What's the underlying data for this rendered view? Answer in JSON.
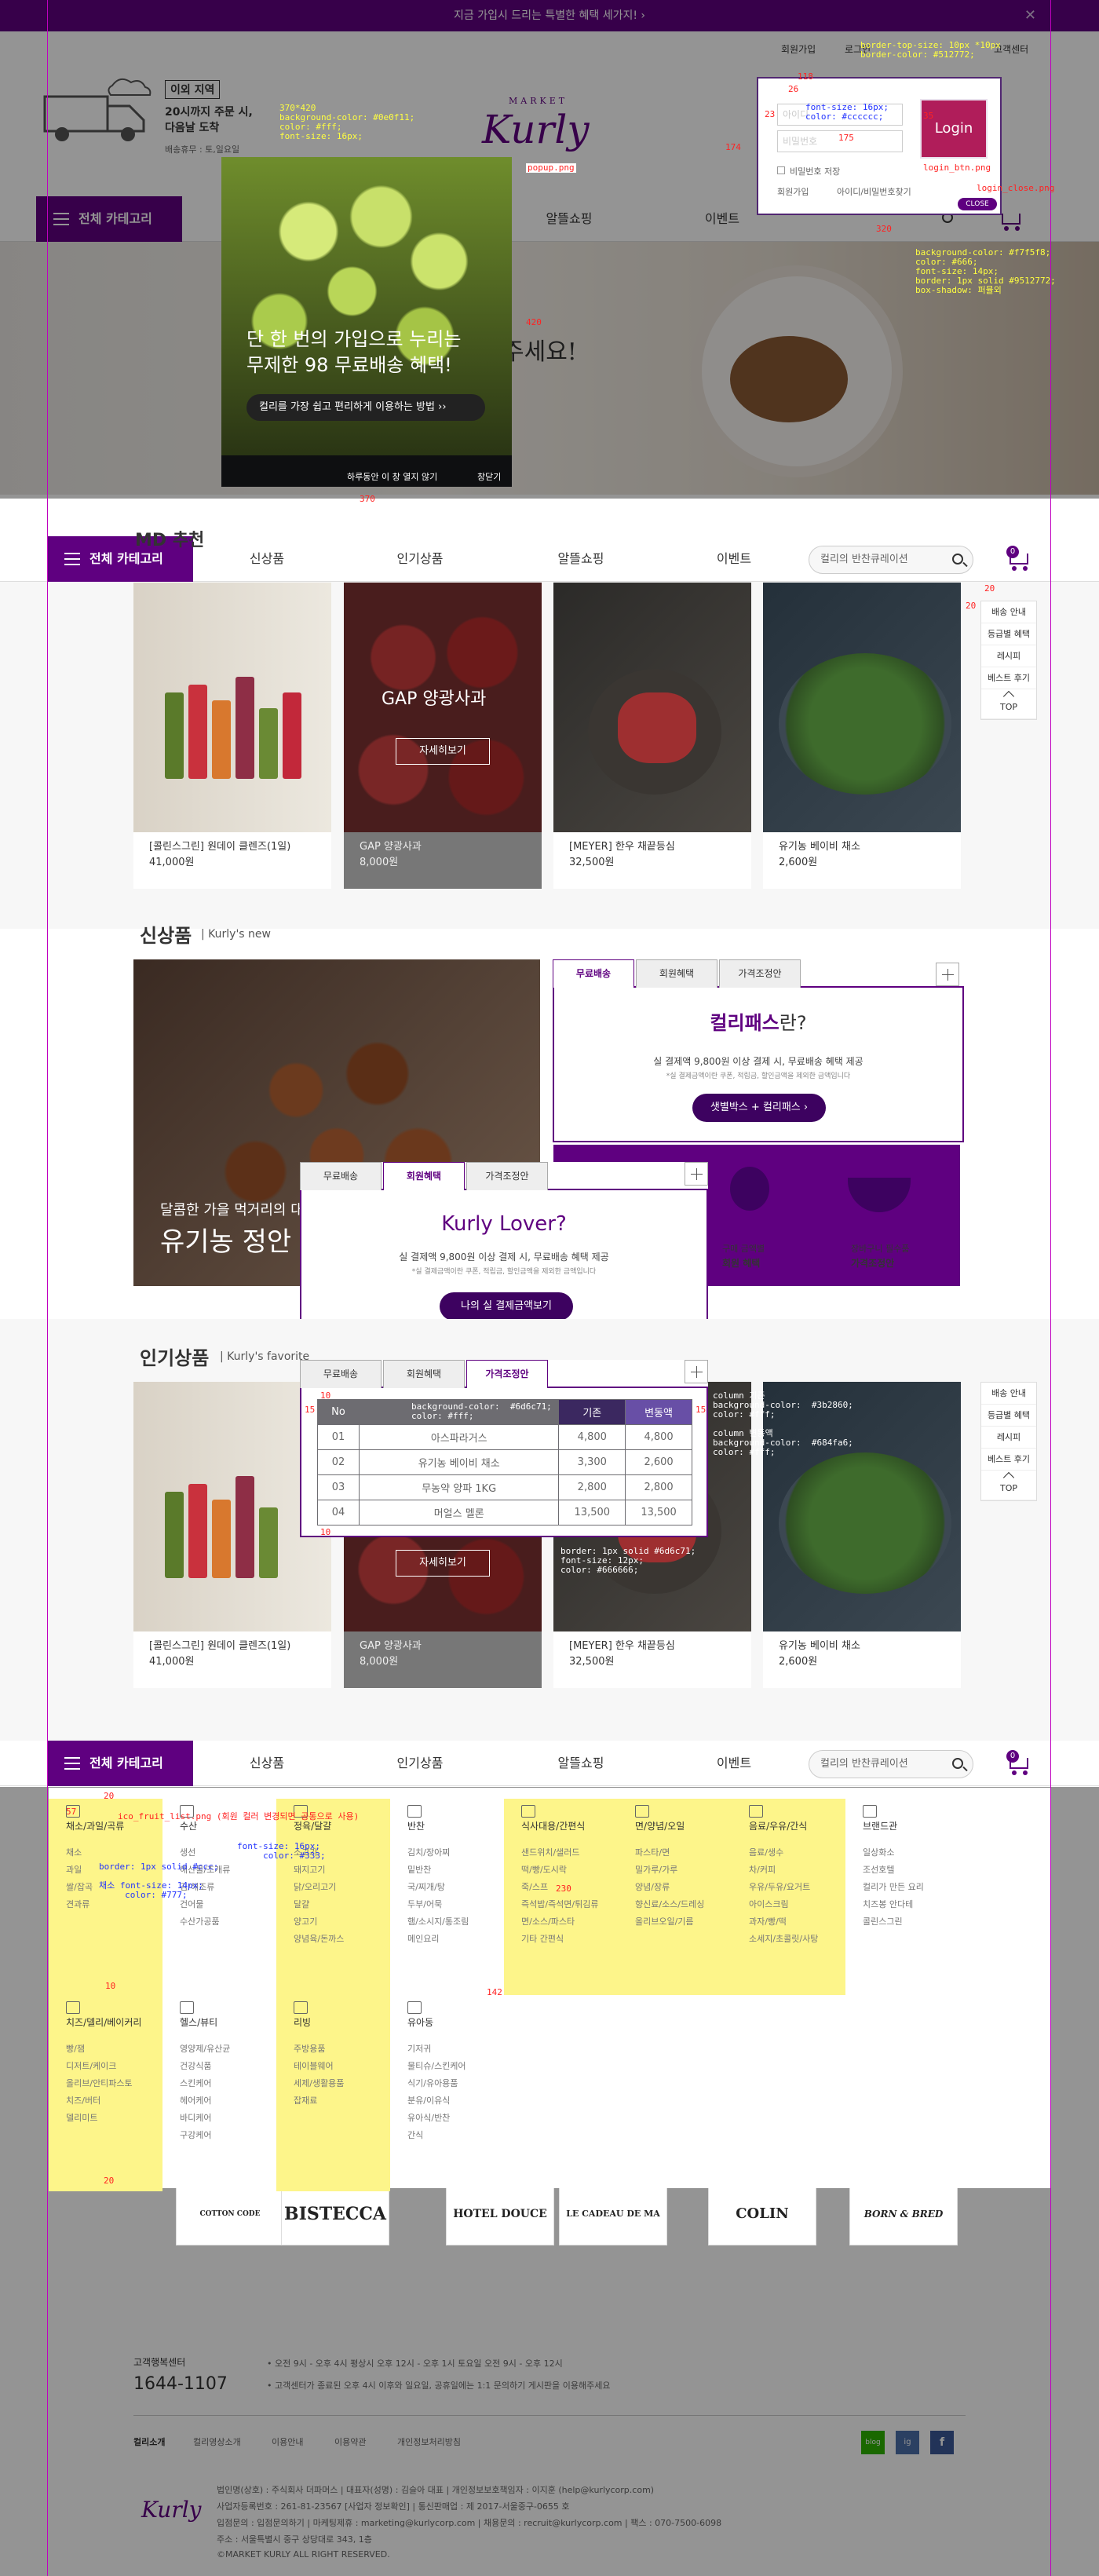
{
  "topbar": {
    "text": "지금 가입시 드리는 특별한 혜택 세가지! ›",
    "close": "✕"
  },
  "header": {
    "delivery": {
      "badge": "이외 지역",
      "line1": "20시까지 주문 시,",
      "line2": "다음날 도착",
      "line3": "배송휴무 : 토,일요일"
    },
    "logo_top": "MARKET",
    "logo": "Kurly",
    "user_links": [
      "회원가입",
      "로그인",
      "고객센터"
    ],
    "category": "전체 카테고리",
    "menus": [
      "신상품",
      "인기상품",
      "알뜰쇼핑",
      "이벤트"
    ],
    "search_placeholder": "컬리의 반찬큐레이션",
    "cart_count": "0"
  },
  "login_popup": {
    "id_placeholder": "아이디",
    "pw_placeholder": "비밀번호",
    "login": "Login",
    "save": "비밀번호 저장",
    "join": "회원가입",
    "find": "아이디/비밀번호찾기",
    "close": "CLOSE"
  },
  "promo_popup": {
    "line1": "단 한 번의 가입으로 누리는",
    "line2": "무제한 98 무료배송 혜택!",
    "button": "컬리를 가장 쉽고 편리하게 이용하는 방법",
    "dismiss": "하루동안 이 창 열지 않기",
    "close": "창닫기"
  },
  "hero": {
    "text": "주세요!"
  },
  "sections": {
    "md": {
      "title": "MD 추천"
    },
    "new": {
      "title": "신상품",
      "sub": "| Kurly's new"
    },
    "pop": {
      "title": "인기상품",
      "sub": "| Kurly's favorite"
    }
  },
  "products": [
    {
      "name": "[콜린스그린] 원데이 클렌즈(1일)",
      "price": "41,000원"
    },
    {
      "name": "GAP 양광사과",
      "price": "8,000원",
      "overlay": "GAP 양광사과",
      "btn": "자세히보기"
    },
    {
      "name": "[MEYER] 한우 채끝등심",
      "price": "32,500원"
    },
    {
      "name": "유기농 베이비 채소",
      "price": "2,600원"
    }
  ],
  "quick": [
    "배송 안내",
    "등급별 혜택",
    "레시피",
    "베스트 후기",
    "TOP"
  ],
  "tab_panel": {
    "tabs": [
      "무료배송",
      "회원혜택",
      "가격조정안"
    ],
    "pass_title": "컬리패스",
    "pass_suffix": "란?",
    "pass_desc": "실 결제액 9,800원 이상 결제 시, 무료배송 혜택 제공",
    "pass_small": "*실 결제금액이란 쿠폰, 적립금, 할인금액을 제외한 금액입니다",
    "pass_btn": "샛별박스 + 컬리패스 ›",
    "lover_title": "Kurly Lover?",
    "lover_desc": "실 결제액 9,800원 이상 결제 시, 무료배송 혜택 제공",
    "lover_small": "*실 결제금액이란 쿠폰, 적립금, 할인금액을 제외한 금액입니다",
    "lover_btn": "나의 실 결제금액보기",
    "badge1": "구매 금액별",
    "badge1b": "회원 혜택",
    "badge2": "장바구니 필수품",
    "badge2b": "가격조정안"
  },
  "new_banner": {
    "line1": "달콤한 가을 먹거리의 대명사",
    "line2": "유기농 정안"
  },
  "price_table": {
    "headers": [
      "No",
      "",
      "기존",
      "변동액"
    ],
    "rows": [
      [
        "01",
        "아스파라거스",
        "4,800",
        "4,800"
      ],
      [
        "02",
        "유기농 베이비 채소",
        "3,300",
        "2,600"
      ],
      [
        "03",
        "무농약 양파 1KG",
        "2,800",
        "2,800"
      ],
      [
        "04",
        "머얼스 멜론",
        "13,500",
        "13,500"
      ]
    ]
  },
  "mega_cols": [
    {
      "title": "채소/과일/곡류",
      "items": [
        "채소",
        "과일",
        "쌀/잡곡",
        "견과류"
      ]
    },
    {
      "title": "수산",
      "items": [
        "생선",
        "해산물/조개류",
        "김/해조류",
        "건어물",
        "수산가공품"
      ]
    },
    {
      "title": "정육/달걀",
      "items": [
        "소고기",
        "돼지고기",
        "닭/오리고기",
        "달걀",
        "양고기",
        "양념육/돈까스"
      ]
    },
    {
      "title": "반찬",
      "items": [
        "김치/장아찌",
        "밑반찬",
        "국/찌개/탕",
        "두부/어묵",
        "햄/소시지/통조림",
        "메인요리"
      ]
    },
    {
      "title": "식사대용/간편식",
      "items": [
        "샌드위치/샐러드",
        "떡/빵/도시락",
        "죽/스프",
        "즉석밥/즉석면/튀김류",
        "면/소스/파스타",
        "기타 간편식"
      ]
    },
    {
      "title": "면/양념/오일",
      "items": [
        "파스타/면",
        "밀가루/가루",
        "양념/장류",
        "향신료/소스/드레싱",
        "올리브오일/기름"
      ]
    },
    {
      "title": "음료/우유/간식",
      "items": [
        "음료/생수",
        "차/커피",
        "우유/두유/요거트",
        "아이스크림",
        "과자/빵/떡",
        "소세지/초콜릿/사탕"
      ]
    },
    {
      "title": "브랜드관",
      "items": [
        "일상화소",
        "조선호텔",
        "컬리가 만든 요리",
        "치즈봉 안다테",
        "콜린스그린"
      ]
    },
    {
      "title": "치즈/델리/베이커리",
      "items": [
        "빵/잼",
        "디저트/케이크",
        "올리브/안티파스토",
        "치즈/버터",
        "델리미트"
      ]
    },
    {
      "title": "헬스/뷰티",
      "items": [
        "영양제/유산균",
        "건강식품",
        "스킨케어",
        "헤어케어",
        "바디케어",
        "구강케어"
      ]
    },
    {
      "title": "리빙",
      "items": [
        "주방용품",
        "테이블웨어",
        "세제/생활용품",
        "잡재료"
      ]
    },
    {
      "title": "유아동",
      "items": [
        "기저귀",
        "물티슈/스킨케어",
        "식기/유아용품",
        "분유/이유식",
        "유아식/반찬",
        "간식"
      ]
    }
  ],
  "brands": [
    "COTTON CODE",
    "BISTECCA",
    "HOTEL DOUCE",
    "LE CADEAU DE MA VIE",
    "COLIN GREEN",
    "BORN & BRED"
  ],
  "footer": {
    "cs_title": "고객행복센터",
    "phone": "1644-1107",
    "hours1": "• 오전 9시 - 오후 4시 평상시 오후 12시 - 오후 1시 토요일 오전 9시 - 오후 12시",
    "hours2": "• 고객센터가 종료된 오후 4시 이후와 일요일, 공휴일에는 1:1 문의하기 게시판을 이용해주세요",
    "links": [
      "컬리소개",
      "컬리영상소개",
      "이용안내",
      "이용약관",
      "개인정보처리방침"
    ],
    "info1": "법인명(상호) : 주식회사 더파머스 | 대표자(성명) : 김슬아 대표 | 개인정보보호책임자 : 이지훈 (help@kurlycorp.com)",
    "info2": "사업자등록번호 : 261-81-23567 [사업자 정보확인] | 통신판매업 : 제 2017-서울중구-0655 호",
    "info3": "입점문의 : 입점문의하기 | 마케팅제휴 : marketing@kurlycorp.com | 채용문의 : recruit@kurlycorp.com | 팩스 : 070-7500-6098",
    "info4": "주소 : 서울특별시 중구 상당대로 343, 1층",
    "copy": "©MARKET KURLY ALL RIGHT RESERVED.",
    "social": [
      "blog",
      "ig",
      "f"
    ]
  },
  "annotations": {
    "promo_size": "370*420\nbackground-color: #0e0f11;\ncolor: #fff;\nfont-size: 16px;",
    "popup_png": "popup.png",
    "num_420": "420",
    "num_370": "370",
    "num_174": "174",
    "num_118": "118",
    "num_26": "26",
    "num_23": "23",
    "num_175": "175",
    "num_35": "35",
    "num_320": "320",
    "num_20": "20",
    "num_10": "10",
    "num_15": "15",
    "num_57": "57",
    "num_230": "230",
    "num_142": "142",
    "login_border": "border-top-size: 10px *10px\nborder-color: #512772;",
    "login_input": "font-size: 16px;\ncolor: #cccccc;",
    "login_btn": "login_btn.png",
    "login_close": "login_close.png",
    "right_style": "background-color: #f7f5f8;\ncolor: #666;\nfont-size: 14px;\nborder: 1px solid #9512772;\nbox-shadow: 퍼뮬외",
    "th_style": "background-color:  #6d6c71;\ncolor: #fff;",
    "col_style": "column 기존\nbackground-color:  #3b2860;\ncolor: #fff;\n\ncolumn 변동액\nbackground-color:  #684fa6;\ncolor: #fff;",
    "td_style": "border: 1px solid #6d6c71;\nfont-size: 12px;\ncolor: #666666;",
    "ico_note": "ico_fruit_list.png (회원 컬러 변경되면 공통으로 사용)",
    "mega_a": "채소 font-size: 14px;\n     color: #777;",
    "mega_b": "font-size: 16px;\n     color: #333;",
    "mega_c": "border: 1px solid #ccc;"
  }
}
